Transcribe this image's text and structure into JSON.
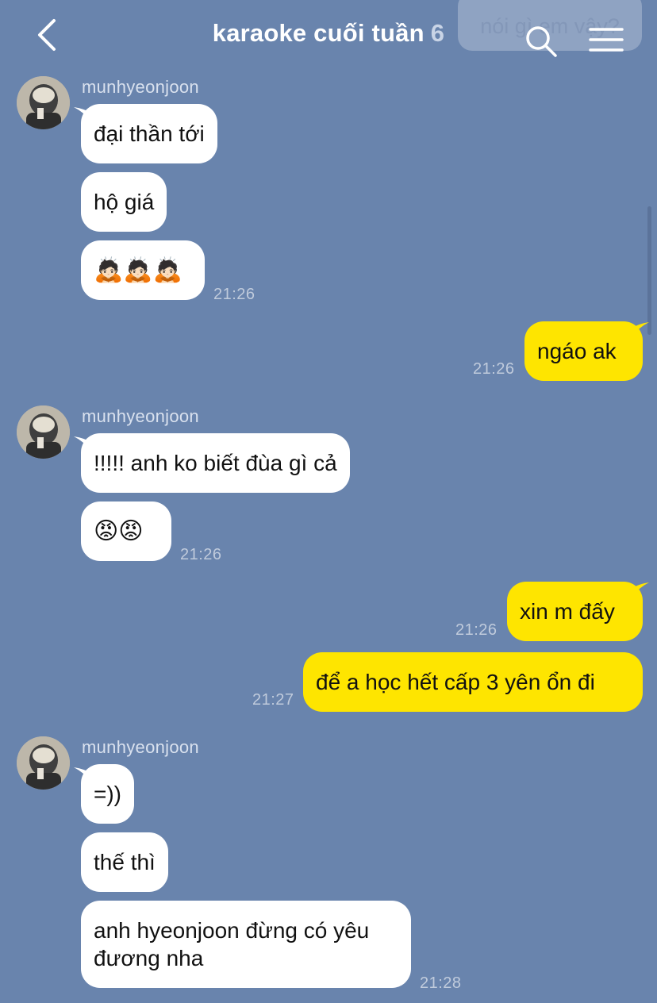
{
  "header": {
    "title": "karaoke cuối tuần",
    "member_count": "6",
    "back_icon": "chevron-left-icon",
    "search_icon": "search-icon",
    "menu_icon": "hamburger-menu-icon"
  },
  "pinned_preview": "nói gì em vậy?",
  "messages": [
    {
      "sender": "munhyeonjoon",
      "direction": "in",
      "bubbles": [
        "đại thần tới",
        "hộ giá",
        "🙇🏻🙇🏻🙇🏻"
      ],
      "time": "21:26"
    },
    {
      "direction": "out",
      "bubbles": [
        "ngáo ak"
      ],
      "time": "21:26"
    },
    {
      "sender": "munhyeonjoon",
      "direction": "in",
      "bubbles": [
        "!!!!! anh ko biết đùa gì cả",
        "😡😡"
      ],
      "time": "21:26"
    },
    {
      "direction": "out",
      "bubbles": [
        "xin m đấy"
      ],
      "time": "21:26"
    },
    {
      "direction": "out",
      "bubbles": [
        "để a học hết cấp 3 yên ổn đi"
      ],
      "time": "21:27"
    },
    {
      "sender": "munhyeonjoon",
      "direction": "in",
      "bubbles": [
        "=))",
        "thế thì",
        "anh hyeonjoon đừng có yêu\nđương nha"
      ],
      "time": "21:28"
    }
  ],
  "colors": {
    "background": "#6984AD",
    "incoming_bubble": "#FFFFFF",
    "outgoing_bubble": "#FEE500"
  }
}
